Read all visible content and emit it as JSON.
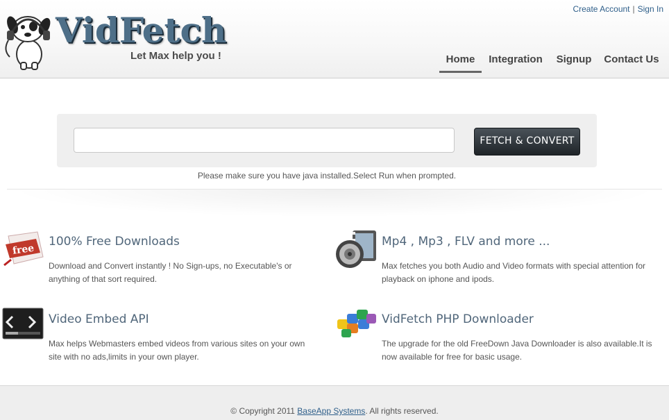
{
  "brand": {
    "name": "VidFetch",
    "tagline": "Let Max help you !"
  },
  "account": {
    "create_account": "Create Account",
    "separator": "|",
    "sign_in": "Sign In"
  },
  "nav": {
    "items": [
      "Home",
      "Integration",
      "Signup",
      "Contact Us"
    ],
    "active": "Home"
  },
  "search": {
    "input_value": "",
    "button_label": "FETCH & CONVERT",
    "note": "Please make sure you have java installed.Select Run when prompted."
  },
  "features": [
    {
      "icon": "free-tag-icon",
      "title": "100% Free Downloads",
      "description": "Download and Convert instantly ! No Sign-ups, no Executable's or anything of that sort required."
    },
    {
      "icon": "speaker-film-icon",
      "title": "Mp4 , Mp3 , FLV and more ...",
      "description": "Max fetches you both Audio and Video formats with special attention for playback on iphone and ipods."
    },
    {
      "icon": "embed-code-icon",
      "title": "Video Embed API",
      "description": "Max helps Webmasters embed videos from various sites on your own site with no ads,limits in your own player."
    },
    {
      "icon": "puzzle-icon",
      "title": "VidFetch PHP Downloader",
      "description": "The upgrade for the old FreeDown Java Downloader is also available.It is now available for free for basic usage."
    }
  ],
  "footer": {
    "copyright_prefix": "© Copyright 2011 ",
    "company": "BaseApp Systems",
    "copyright_suffix": ". All rights reserved."
  },
  "colors": {
    "brand_blue": "#4e6f88",
    "link_blue": "#2f5f8a",
    "button_dark": "#2a3034",
    "heading": "#50667a"
  }
}
